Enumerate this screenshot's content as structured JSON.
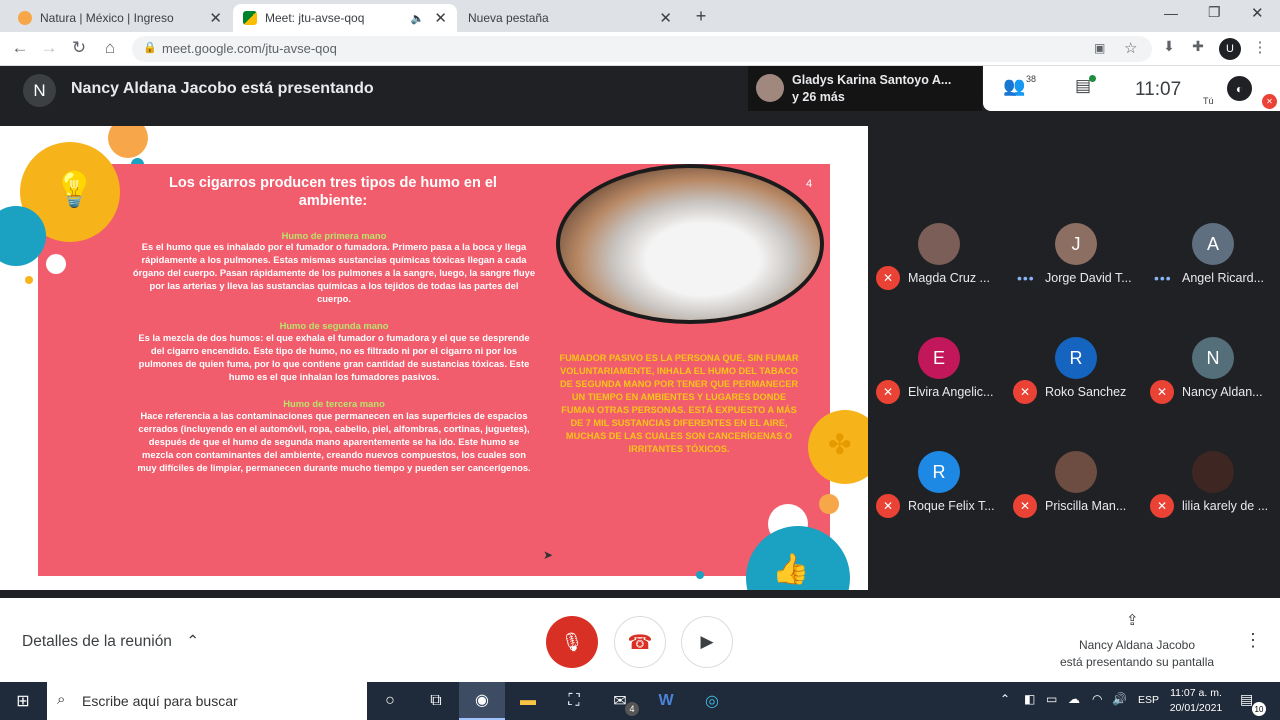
{
  "browser": {
    "tabs": [
      {
        "title": "Natura | México | Ingreso",
        "active": false
      },
      {
        "title": "Meet: jtu-avse-qoq",
        "active": true
      },
      {
        "title": "Nueva pestaña",
        "active": false
      }
    ],
    "new_tab_symbol": "+",
    "url": "meet.google.com/jtu-avse-qoq",
    "profile_initial": "U"
  },
  "meet": {
    "presenter_initial": "N",
    "presenting_title": "Nancy Aldana Jacobo está presentando",
    "group_names_line1": "Gladys Karina Santoyo A...",
    "group_names_line2": "y 26 más",
    "participant_count": "38",
    "clock": "11:07",
    "self_label": "Tú",
    "meeting_details": "Detalles de la reunión",
    "presenting_note_line1": "Nancy Aldana Jacobo",
    "presenting_note_line2": "está presentando su pantalla"
  },
  "slide": {
    "page_number": "4",
    "title": "Los cigarros producen tres tipos de humo en el ambiente:",
    "section1_title": "Humo de primera mano",
    "section1_body": "Es el humo que es inhalado por el fumador o fumadora. Primero pasa a la boca y llega rápidamente a los pulmones. Estas mismas sustancias químicas tóxicas llegan a cada órgano del cuerpo. Pasan rápidamente de los pulmones a la sangre, luego, la sangre fluye por las arterias y lleva las sustancias químicas a los tejidos de todas las partes del cuerpo.",
    "section2_title": "Humo de segunda mano",
    "section2_body": "Es la mezcla de dos humos: el que exhala el fumador o fumadora y el que se desprende del cigarro encendido. Este tipo de humo, no es filtrado ni por el cigarro ni por los pulmones de quien fuma, por lo que contiene gran cantidad de sustancias tóxicas. Este humo es el que inhalan los fumadores pasivos.",
    "section3_title": "Humo de tercera mano",
    "section3_body": "Hace referencia a las contaminaciones que permanecen en las superficies de espacios cerrados (incluyendo en el automóvil, ropa, cabello, piel, alfombras, cortinas, juguetes), después de que el humo de segunda mano aparentemente se ha ido. Este humo se mezcla con contaminantes del ambiente, creando nuevos compuestos, los cuales son muy difíciles de limpiar, permanecen durante mucho tiempo y pueden ser cancerígenos.",
    "passive_text": "FUMADOR PASIVO ES LA PERSONA QUE, SIN FUMAR VOLUNTARIAMENTE, INHALA EL HUMO DEL TABACO DE SEGUNDA MANO POR TENER QUE PERMANECER UN TIEMPO EN AMBIENTES Y LUGARES DONDE FUMAN OTRAS PERSONAS. ESTÁ EXPUESTO A MÁS DE 7 MIL SUSTANCIAS DIFERENTES EN EL AIRE, MUCHAS DE LAS CUALES SON CANCERÍGENAS O IRRITANTES TÓXICOS."
  },
  "participants": [
    {
      "initial": "",
      "name": "Magda Cruz ...",
      "color": "#7b5e57",
      "muted": true
    },
    {
      "initial": "J",
      "name": "Jorge David T...",
      "color": "#8d6e63",
      "muted": false
    },
    {
      "initial": "A",
      "name": "Angel Ricard...",
      "color": "#5f6f80",
      "muted": false
    },
    {
      "initial": "E",
      "name": "Elvira Angelic...",
      "color": "#c2185b",
      "muted": true
    },
    {
      "initial": "R",
      "name": "Roko Sanchez",
      "color": "#1565c0",
      "muted": true
    },
    {
      "initial": "N",
      "name": "Nancy Aldan...",
      "color": "#546e7a",
      "muted": true
    },
    {
      "initial": "R",
      "name": "Roque Felix T...",
      "color": "#1e88e5",
      "muted": true
    },
    {
      "initial": "",
      "name": "Priscilla Man...",
      "color": "#6d4c41",
      "muted": true
    },
    {
      "initial": "",
      "name": "lilia karely de ...",
      "color": "#3e2723",
      "muted": true
    }
  ],
  "taskbar": {
    "search_placeholder": "Escribe aquí para buscar",
    "language": "ESP",
    "time": "11:07 a. m.",
    "date": "20/01/2021",
    "mail_badge": "4",
    "notification_count": "10"
  },
  "colors": {
    "meet_bg": "#202124",
    "slide_red": "#f25d6e",
    "mic_red": "#ea4335",
    "slide_subtitle_green": "#b9e36b",
    "slide_yellow": "#f5c518"
  }
}
